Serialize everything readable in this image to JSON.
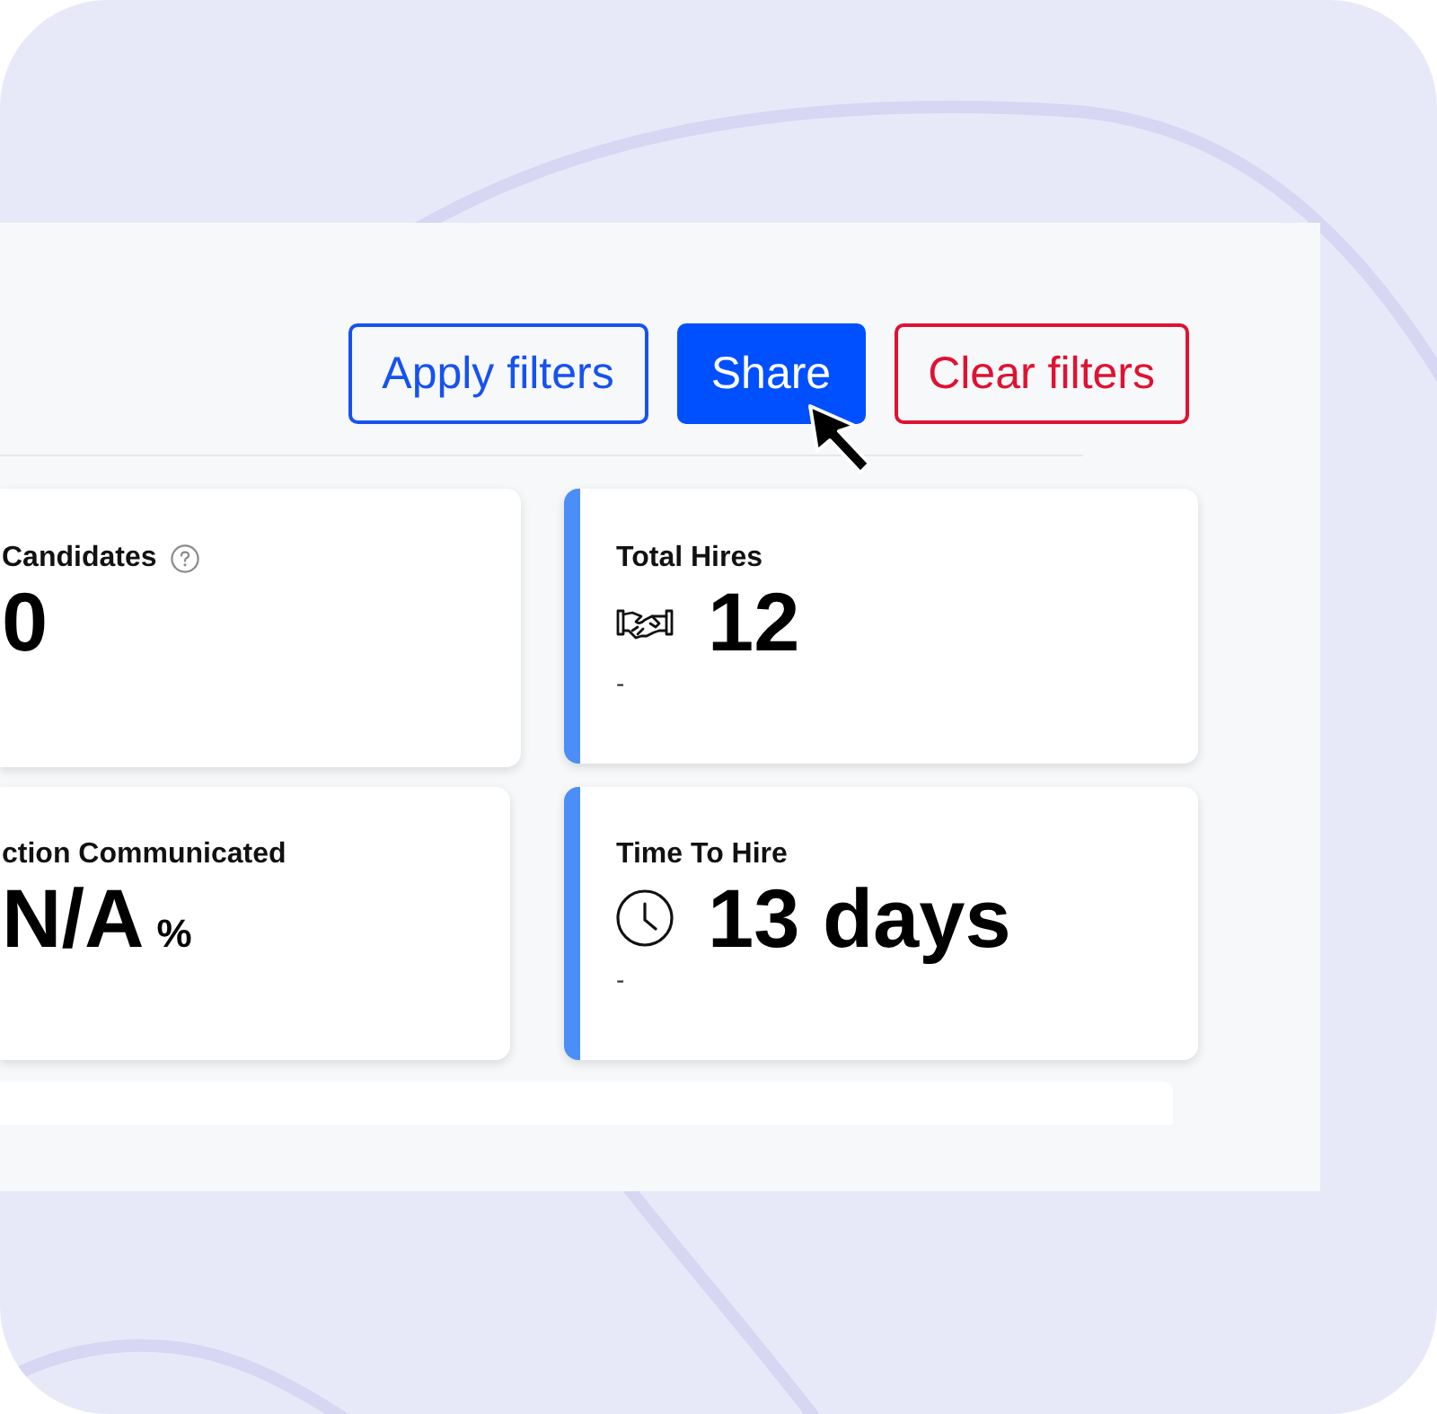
{
  "toolbar": {
    "buttons": [
      {
        "label": "Apply filters",
        "kind": "outline"
      },
      {
        "label": "Share",
        "kind": "primary"
      },
      {
        "label": "Clear filters",
        "kind": "danger"
      }
    ]
  },
  "metrics": [
    {
      "title": "Candidates",
      "info_icon": true,
      "value": "0",
      "accent": false
    },
    {
      "title": "Total Hires",
      "info_icon": false,
      "value": "12",
      "subtext": "-",
      "accent": true
    },
    {
      "title": "ction Communicated",
      "info_icon": false,
      "value": "N/A",
      "unit": "%",
      "accent": false
    },
    {
      "title": "Time To Hire",
      "info_icon": false,
      "value": "13 days",
      "subtext": "-",
      "accent": true
    }
  ]
}
